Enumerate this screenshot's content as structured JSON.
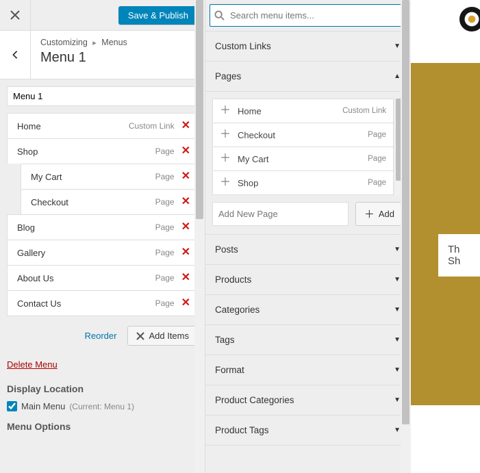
{
  "header": {
    "save_publish": "Save & Publish"
  },
  "breadcrumb": {
    "parent": "Customizing",
    "location": "Menus",
    "title": "Menu 1"
  },
  "menu_name": "Menu 1",
  "menu_items": [
    {
      "label": "Home",
      "type": "Custom Link",
      "indent": 0
    },
    {
      "label": "Shop",
      "type": "Page",
      "indent": 0
    },
    {
      "label": "My Cart",
      "type": "Page",
      "indent": 1
    },
    {
      "label": "Checkout",
      "type": "Page",
      "indent": 1
    },
    {
      "label": "Blog",
      "type": "Page",
      "indent": 0
    },
    {
      "label": "Gallery",
      "type": "Page",
      "indent": 0
    },
    {
      "label": "About Us",
      "type": "Page",
      "indent": 0
    },
    {
      "label": "Contact Us",
      "type": "Page",
      "indent": 0
    }
  ],
  "actions": {
    "reorder": "Reorder",
    "add_items": "Add Items",
    "delete_menu": "Delete Menu"
  },
  "display_location": {
    "heading": "Display Location",
    "checkbox_label": "Main Menu",
    "current": "(Current: Menu 1)"
  },
  "menu_options_heading": "Menu Options",
  "search": {
    "placeholder": "Search menu items..."
  },
  "sections": {
    "custom_links": "Custom Links",
    "pages": "Pages",
    "posts": "Posts",
    "products": "Products",
    "categories": "Categories",
    "tags": "Tags",
    "format": "Format",
    "product_categories": "Product Categories",
    "product_tags": "Product Tags"
  },
  "pages_items": [
    {
      "label": "Home",
      "type": "Custom Link"
    },
    {
      "label": "Checkout",
      "type": "Page"
    },
    {
      "label": "My Cart",
      "type": "Page"
    },
    {
      "label": "Shop",
      "type": "Page"
    }
  ],
  "add_new": {
    "placeholder": "Add New Page",
    "button": "Add"
  },
  "preview": {
    "line1": "Th",
    "line2": "Sh"
  }
}
